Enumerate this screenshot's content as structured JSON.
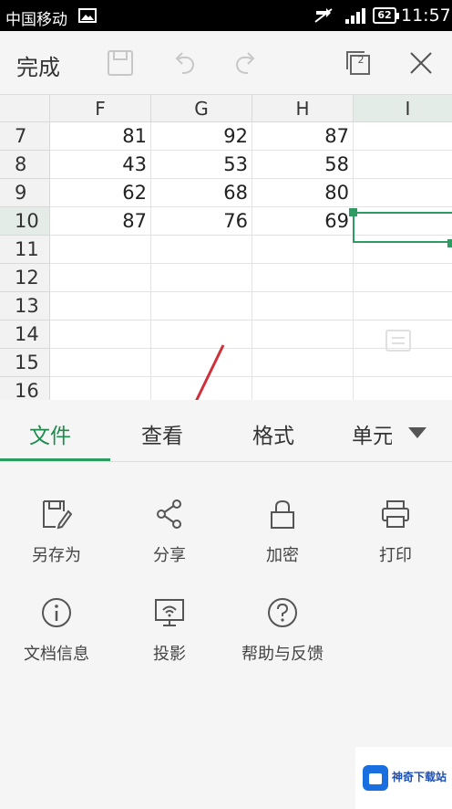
{
  "status_bar": {
    "carrier": "中国移动",
    "battery": "62",
    "time": "11:57"
  },
  "toolbar": {
    "done_label": "完成",
    "window_count": "2"
  },
  "sheet": {
    "columns": [
      "F",
      "G",
      "H",
      "I"
    ],
    "rows": [
      {
        "num": "7",
        "cells": [
          "81",
          "92",
          "87",
          ""
        ]
      },
      {
        "num": "8",
        "cells": [
          "43",
          "53",
          "58",
          ""
        ]
      },
      {
        "num": "9",
        "cells": [
          "62",
          "68",
          "80",
          ""
        ]
      },
      {
        "num": "10",
        "cells": [
          "87",
          "76",
          "69",
          ""
        ]
      },
      {
        "num": "11",
        "cells": [
          "",
          "",
          "",
          ""
        ]
      },
      {
        "num": "12",
        "cells": [
          "",
          "",
          "",
          ""
        ]
      },
      {
        "num": "13",
        "cells": [
          "",
          "",
          "",
          ""
        ]
      },
      {
        "num": "14",
        "cells": [
          "",
          "",
          "",
          ""
        ]
      },
      {
        "num": "15",
        "cells": [
          "",
          "",
          "",
          ""
        ]
      },
      {
        "num": "16",
        "cells": [
          "",
          "",
          "",
          ""
        ]
      }
    ],
    "selected_row": "10",
    "selected_column": "I"
  },
  "tabs": [
    {
      "label": "文件",
      "active": true
    },
    {
      "label": "查看",
      "active": false
    },
    {
      "label": "格式",
      "active": false
    },
    {
      "label": "单元",
      "active": false
    }
  ],
  "menu": {
    "items": [
      {
        "label": "另存为",
        "icon": "save-as-icon"
      },
      {
        "label": "分享",
        "icon": "share-icon"
      },
      {
        "label": "加密",
        "icon": "lock-icon"
      },
      {
        "label": "打印",
        "icon": "printer-icon"
      },
      {
        "label": "文档信息",
        "icon": "info-icon"
      },
      {
        "label": "投影",
        "icon": "projection-icon"
      },
      {
        "label": "帮助与反馈",
        "icon": "help-icon"
      }
    ]
  },
  "watermark": {
    "text": "神奇下载站"
  },
  "colors": {
    "accent": "#2e9b62",
    "arrow": "#d0303a"
  }
}
